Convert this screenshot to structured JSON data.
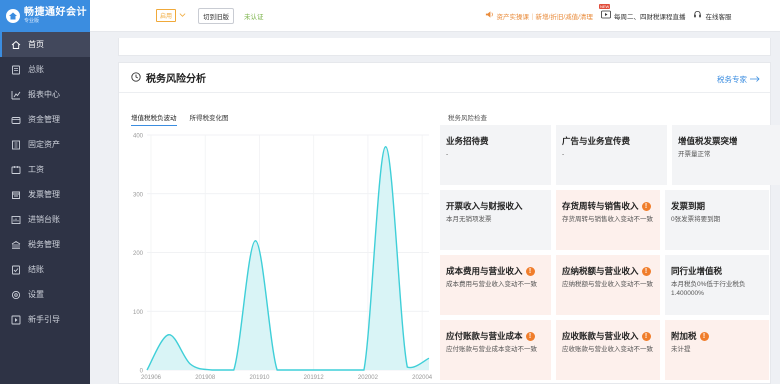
{
  "app": {
    "logo_title": "畅捷通好会计",
    "logo_edition": "专业版"
  },
  "sidebar": {
    "items": [
      {
        "label": "首页",
        "icon": "home-icon",
        "active": true
      },
      {
        "label": "总账",
        "icon": "ledger-icon"
      },
      {
        "label": "报表中心",
        "icon": "report-icon"
      },
      {
        "label": "资金管理",
        "icon": "fund-icon"
      },
      {
        "label": "固定资产",
        "icon": "asset-icon"
      },
      {
        "label": "工资",
        "icon": "salary-icon"
      },
      {
        "label": "发票管理",
        "icon": "invoice-icon"
      },
      {
        "label": "进销台账",
        "icon": "inventory-icon"
      },
      {
        "label": "税务管理",
        "icon": "tax-icon"
      },
      {
        "label": "结账",
        "icon": "close-account-icon"
      },
      {
        "label": "设置",
        "icon": "settings-icon"
      },
      {
        "label": "新手引导",
        "icon": "guide-icon"
      }
    ]
  },
  "topbar": {
    "status": "启用",
    "switch_label": "切到旧版",
    "verify_status": "未认证",
    "notice": "资产实操课｜新增/折旧/减值/清理",
    "class_badge": "NEW",
    "class_info": "每周二、四财税课程直播",
    "help_label": "在线客服"
  },
  "card": {
    "title": "税务风险分析",
    "expert_link": "税务专家",
    "tabs": [
      "增值税税负波动",
      "所得税变化图"
    ],
    "risk_title": "税务风险检查"
  },
  "chart_data": {
    "type": "line",
    "x_ticks": [
      "201906",
      "201908",
      "201910",
      "201912",
      "202002",
      "202004"
    ],
    "y_ticks": [
      "0",
      "100",
      "200",
      "300",
      "400"
    ],
    "ylim": [
      0,
      400
    ],
    "points": [
      {
        "x": 0,
        "y": 0
      },
      {
        "x": 1,
        "y": 60
      },
      {
        "x": 2,
        "y": 10
      },
      {
        "x": 3,
        "y": 0
      },
      {
        "x": 4,
        "y": 0
      },
      {
        "x": 5,
        "y": 220
      },
      {
        "x": 6,
        "y": 0
      },
      {
        "x": 7,
        "y": 0
      },
      {
        "x": 8,
        "y": 0
      },
      {
        "x": 9,
        "y": 0
      },
      {
        "x": 10,
        "y": 0
      },
      {
        "x": 11,
        "y": 380
      },
      {
        "x": 12,
        "y": 5
      },
      {
        "x": 13,
        "y": 20
      }
    ],
    "colors": {
      "line": "#3fcfd8",
      "fill": "#d9f4f6"
    }
  },
  "risk_tiles": [
    [
      {
        "title": "业务招待费",
        "desc": "-",
        "warn": false
      },
      {
        "title": "广告与业务宣传费",
        "desc": "-",
        "warn": false
      },
      {
        "title": "增值税发票突增",
        "desc": "开票量正常",
        "warn": false
      }
    ],
    [
      {
        "title": "开票收入与财报收入",
        "desc": "本月无销项发票",
        "warn": false
      },
      {
        "title": "存货周转与销售收入",
        "desc": "存货周转与销售收入变动不一致",
        "warn": true
      },
      {
        "title": "发票到期",
        "desc": "0张发票将要到期",
        "warn": false
      }
    ],
    [
      {
        "title": "成本费用与营业收入",
        "desc": "成本费用与营业收入变动不一致",
        "warn": true
      },
      {
        "title": "应纳税额与营业收入",
        "desc": "应纳税额与营业收入变动不一致",
        "warn": true
      },
      {
        "title": "同行业增值税",
        "desc": "本月税负0%低于行业税负1.400000%",
        "warn": false
      }
    ],
    [
      {
        "title": "应付账款与营业成本",
        "desc": "应付账款与营业成本变动不一致",
        "warn": true
      },
      {
        "title": "应收账款与营业收入",
        "desc": "应收账款与营业收入变动不一致",
        "warn": true
      },
      {
        "title": "附加税",
        "desc": "未计提",
        "warn": true
      }
    ]
  ]
}
